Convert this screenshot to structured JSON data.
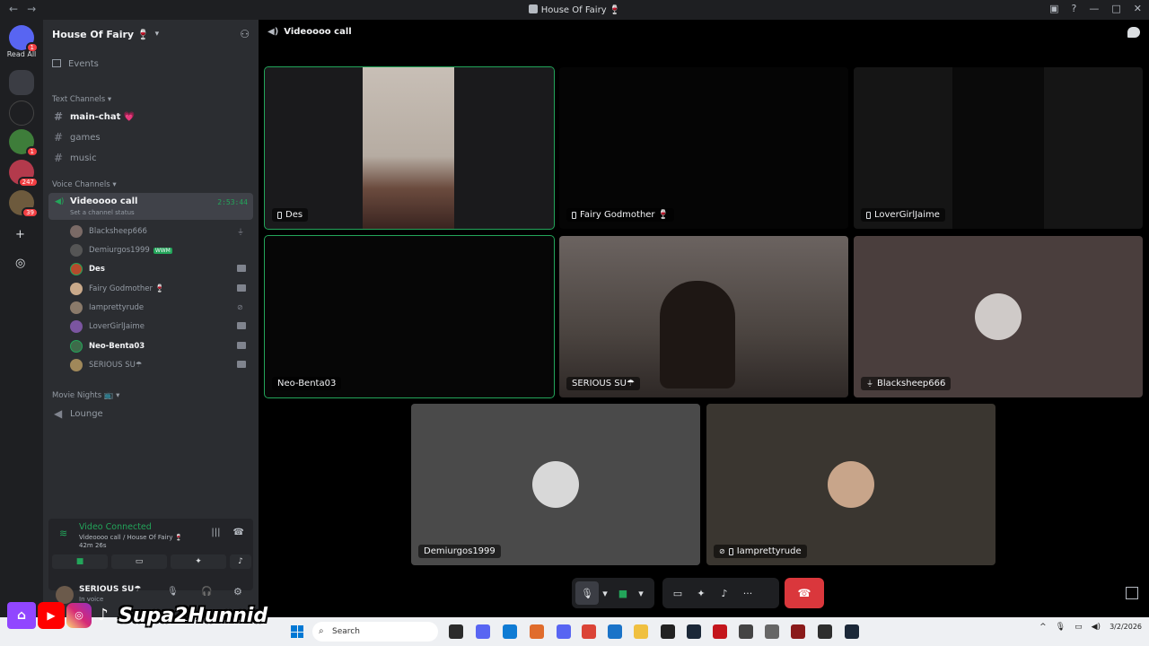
{
  "window": {
    "title": "House Of Fairy 🍷"
  },
  "rail": {
    "read_all": "Read All",
    "badges": [
      "1",
      "1",
      "247",
      "39"
    ]
  },
  "sidebar": {
    "guild_name": "House Of Fairy 🍷",
    "events": "Events",
    "text_category": "Text Channels",
    "text_channels": [
      "main-chat 💗",
      "games",
      "music"
    ],
    "voice_category": "Voice Channels",
    "voice_channel": {
      "name": "Videoooo call",
      "status": "Set a channel status",
      "time": "2:53:44"
    },
    "members": [
      {
        "name": "Blacksheep666"
      },
      {
        "name": "Demiurgos1999",
        "tag": "WWM"
      },
      {
        "name": "Des"
      },
      {
        "name": "Fairy Godmother 🍷"
      },
      {
        "name": "Iamprettyrude"
      },
      {
        "name": "LoverGirlJaime"
      },
      {
        "name": "Neo-Benta03"
      },
      {
        "name": "SERIOUS SU☂"
      }
    ],
    "movie_category": "Movie Nights 📺",
    "lounge": "Lounge"
  },
  "voice_panel": {
    "connected": "Video Connected",
    "subtitle": "Videoooo call / House Of Fairy 🍷",
    "elapsed": "42m 26s"
  },
  "user_bar": {
    "name": "SERIOUS SU☂",
    "sub": "In voice"
  },
  "brand": {
    "text": "Supa2Hunnid"
  },
  "main": {
    "header": "Videoooo call",
    "tiles": [
      {
        "label": "Des"
      },
      {
        "label": "Fairy Godmother 🍷"
      },
      {
        "label": "LoverGirlJaime"
      },
      {
        "label": "Neo-Benta03"
      },
      {
        "label": "SERIOUS SU☂"
      },
      {
        "label": "Blacksheep666"
      },
      {
        "label": "Demiurgos1999"
      },
      {
        "label": "Iamprettyrude"
      }
    ]
  },
  "taskbar": {
    "search": "Search",
    "date": "3/2/2026"
  },
  "colors": {
    "accent_green": "#23a55a",
    "leave_red": "#da373c",
    "sidebar_bg": "#2b2d31"
  }
}
